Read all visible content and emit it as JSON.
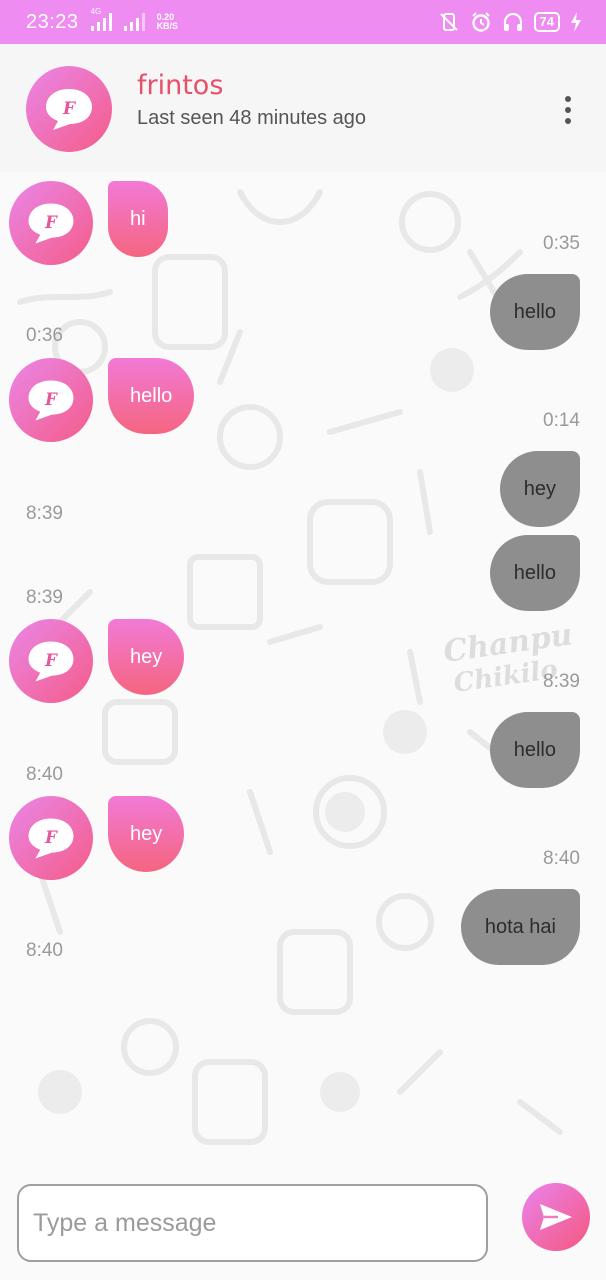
{
  "status_bar": {
    "time": "23:23",
    "network": "4G",
    "speed_value": "0.20",
    "speed_unit": "KB/S",
    "battery": "74"
  },
  "header": {
    "name": "frintos",
    "status": "Last seen 48 minutes ago"
  },
  "messages": [
    {
      "direction": "in",
      "text": "hi"
    },
    {
      "time": "0:35"
    },
    {
      "direction": "out",
      "text": "hello"
    },
    {
      "time": "0:36"
    },
    {
      "direction": "in",
      "text": "hello"
    },
    {
      "time": "0:14"
    },
    {
      "direction": "out",
      "text": "hey"
    },
    {
      "time": "8:39"
    },
    {
      "direction": "out",
      "text": "hello"
    },
    {
      "time": "8:39"
    },
    {
      "direction": "in",
      "text": "hey"
    },
    {
      "time": "8:39"
    },
    {
      "direction": "out",
      "text": "hello"
    },
    {
      "time": "8:40"
    },
    {
      "direction": "in",
      "text": "hey"
    },
    {
      "time": "8:40"
    },
    {
      "direction": "out",
      "text": "hota hai"
    },
    {
      "time": "8:40"
    }
  ],
  "input": {
    "placeholder": "Type a message",
    "value": ""
  },
  "colors": {
    "status_bar": "#ee8cf2",
    "accent_name": "#e8506a",
    "incoming_top": "#f27ad6",
    "incoming_bottom": "#f5657f",
    "outgoing": "#8e8e8e"
  },
  "icons": {
    "menu": "more-vertical-icon",
    "send": "send-icon",
    "avatar": "logo-icon"
  }
}
